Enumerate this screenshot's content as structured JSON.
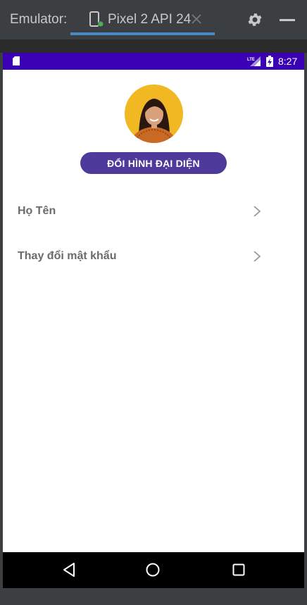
{
  "emulator": {
    "label": "Emulator:",
    "tab_title": "Pixel 2 API 24",
    "icons": {
      "device": "phone-device-icon",
      "close": "close-icon",
      "settings": "gear-icon",
      "minimize": "minimize-icon"
    }
  },
  "status_bar": {
    "time": "8:27",
    "network": "LTE",
    "color": "#3b00b3"
  },
  "profile": {
    "change_avatar_label": "ĐỔI HÌNH ĐẠI DIỆN",
    "button_color": "#4e3a9a"
  },
  "menu": {
    "items": [
      {
        "label": "Họ Tên"
      },
      {
        "label": "Thay đổi mật khẩu"
      }
    ]
  },
  "nav_bar": {
    "icons": [
      "back-icon",
      "home-icon",
      "recents-icon"
    ]
  }
}
